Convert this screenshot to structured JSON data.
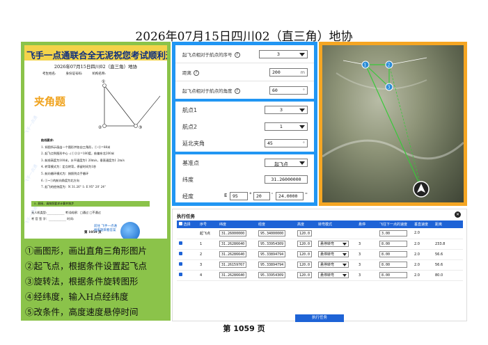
{
  "page": {
    "title": "2026年07月15日四川02（直三角）地协",
    "footer": "第 1059 页"
  },
  "doc": {
    "banner": "飞手一点通联合全无泥祝您考试顺利通过",
    "subtitle": "2026年07月15日四川02（直三角）地协",
    "fields": [
      "考生姓名:",
      "身份证号码:",
      "机构名称:"
    ],
    "tag": "夹角题",
    "req_title": "航线要求:",
    "requirements": [
      "1. 如图所示画出一个图形并各自三角形，①-②=88米",
      "2. 起飞点到图形中心 ∠①②③=180度，航偏东北200米",
      "3. 航线高度为100米，水平速度为1 20m/s，垂直速度为1 2m/s",
      "4. 转弯模式为：定点转弯，停留时间为1秒",
      "5. 航向循环模式为：按照到点手循环",
      "6. ①→①的航向角度为北方向",
      "7. 起飞的经纬度为：N 31.26° 1: E 95° 20' 24\""
    ],
    "note": "5. 直接，请按照要求计算并按步",
    "sig_lines": [
      "无人机类型:____________ 考试成绩：□通过 □不通过",
      "考 官 签 字：____________ 时间:"
    ],
    "page_label": "第 1059 页",
    "logo_text": [
      "前往 飞手一点通",
      "搜索题目看答案"
    ],
    "points": [
      "①",
      "②",
      "③"
    ],
    "watermark": "飞手一点通"
  },
  "steps": [
    "①画图形，画出直角三角形图片",
    "②起飞点，根据条件设置起飞点",
    "③旋转法，根据条件旋转图形",
    "④经纬度，输入H点经纬度",
    "⑤改条件，高度速度悬停时间"
  ],
  "settings": {
    "takeoff_seq_label": "起飞点相对于航点的序号",
    "takeoff_seq_value": "3",
    "distance_label": "距离",
    "distance_value": "200",
    "distance_unit": "m",
    "angle_label": "起飞点相对于航点的角度",
    "angle_value": "60",
    "angle_unit": "°",
    "wp1_label": "航点1",
    "wp1_value": "3",
    "wp2_label": "航点2",
    "wp2_value": "1",
    "extend_label": "延北夹角",
    "extend_value": "45",
    "extend_unit": "°",
    "base_label": "基准点",
    "base_value": "起飞点",
    "lat_label": "纬度",
    "lat_value": "31.26000000",
    "lon_label": "经度",
    "lon_dir": "E",
    "lon_deg": "95",
    "lon_min": "20",
    "lon_sec": "24.0000",
    "deg_sym": "°",
    "min_sym": "'",
    "sec_sym": "''"
  },
  "map": {
    "labels": [
      "1",
      "2",
      "3"
    ],
    "north": "N"
  },
  "task": {
    "title": "执行任务",
    "columns": [
      "选择",
      "序号",
      "纬度",
      "经度",
      "高度",
      "转弯模式",
      "悬停",
      "飞往下一点的速度",
      "垂直速度",
      "距离"
    ],
    "takeoff_row": {
      "seq": "起飞点",
      "lat": "31.26000000",
      "lon": "95.34000000",
      "alt": "120.0",
      "speed": "3.00",
      "vspeed": "2.0"
    },
    "rows": [
      {
        "seq": "1",
        "lat": "31.26286640",
        "lon": "95.33954309",
        "alt": "120.0",
        "mode": "悬停转弯",
        "hover": "3",
        "speed": "8.00",
        "vspeed": "2.0",
        "dist": "233.8"
      },
      {
        "seq": "2",
        "lat": "31.26286640",
        "lon": "95.33894794",
        "alt": "120.0",
        "mode": "悬停转弯",
        "hover": "3",
        "speed": "8.00",
        "vspeed": "2.0",
        "dist": "56.6"
      },
      {
        "seq": "3",
        "lat": "31.26159767",
        "lon": "95.33894794",
        "alt": "120.0",
        "mode": "悬停转弯",
        "hover": "3",
        "speed": "8.00",
        "vspeed": "2.0",
        "dist": "56.6"
      },
      {
        "seq": "4",
        "lat": "31.26286640",
        "lon": "95.33954309",
        "alt": "120.0",
        "mode": "悬停转弯",
        "hover": "3",
        "speed": "8.00",
        "vspeed": "2.0",
        "dist": "80.0"
      }
    ],
    "execute_label": "执行任务"
  },
  "colors": {
    "green": "#8bc34a",
    "blue": "#2196f3",
    "orange": "#f5a623",
    "accent": "#1e63d6"
  }
}
